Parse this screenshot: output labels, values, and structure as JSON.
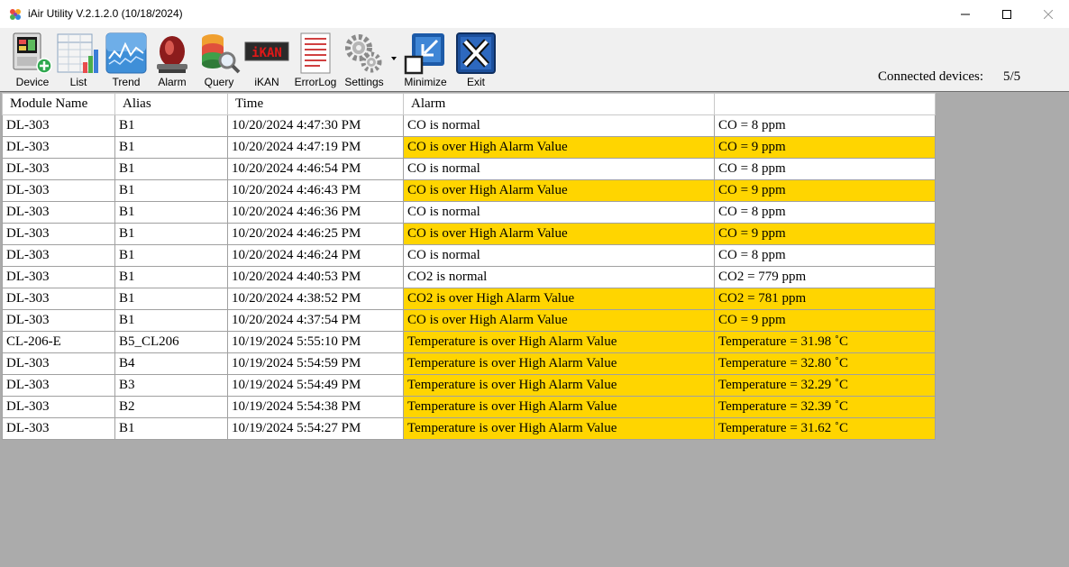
{
  "window": {
    "title": "iAir Utility V.2.1.2.0 (10/18/2024)",
    "icon": "app-flower-icon"
  },
  "toolbar": {
    "buttons": [
      {
        "label": "Device",
        "icon": "device-add-icon"
      },
      {
        "label": "List",
        "icon": "list-chart-icon"
      },
      {
        "label": "Trend",
        "icon": "trend-chart-icon"
      },
      {
        "label": "Alarm",
        "icon": "alarm-siren-icon"
      },
      {
        "label": "Query",
        "icon": "database-query-icon"
      },
      {
        "label": "iKAN",
        "icon": "ikan-display-icon"
      },
      {
        "label": "ErrorLog",
        "icon": "error-log-icon"
      },
      {
        "label": "Settings",
        "icon": "gears-icon"
      },
      {
        "label": "Minimize",
        "icon": "minimize-window-icon"
      },
      {
        "label": "Exit",
        "icon": "exit-x-icon"
      }
    ],
    "connected_label": "Connected devices:",
    "connected_value": "5/5"
  },
  "grid": {
    "headers": [
      "Module Name",
      "Alias",
      "Time",
      "Alarm",
      ""
    ],
    "rows": [
      {
        "module": "DL-303",
        "alias": "B1",
        "time": "10/20/2024 4:47:30 PM",
        "alarm": "CO is normal",
        "value": "CO = 8 ppm",
        "highlight": false
      },
      {
        "module": "DL-303",
        "alias": "B1",
        "time": "10/20/2024 4:47:19 PM",
        "alarm": "CO is over High Alarm  Value",
        "value": "CO = 9 ppm",
        "highlight": true
      },
      {
        "module": "DL-303",
        "alias": "B1",
        "time": "10/20/2024 4:46:54 PM",
        "alarm": "CO is normal",
        "value": "CO = 8 ppm",
        "highlight": false
      },
      {
        "module": "DL-303",
        "alias": "B1",
        "time": "10/20/2024 4:46:43 PM",
        "alarm": "CO is over High Alarm  Value",
        "value": "CO = 9 ppm",
        "highlight": true
      },
      {
        "module": "DL-303",
        "alias": "B1",
        "time": "10/20/2024 4:46:36 PM",
        "alarm": "CO is normal",
        "value": "CO = 8 ppm",
        "highlight": false
      },
      {
        "module": "DL-303",
        "alias": "B1",
        "time": "10/20/2024 4:46:25 PM",
        "alarm": "CO is over High Alarm  Value",
        "value": "CO = 9 ppm",
        "highlight": true
      },
      {
        "module": "DL-303",
        "alias": "B1",
        "time": "10/20/2024 4:46:24 PM",
        "alarm": "CO is normal",
        "value": "CO = 8 ppm",
        "highlight": false
      },
      {
        "module": "DL-303",
        "alias": "B1",
        "time": "10/20/2024 4:40:53 PM",
        "alarm": "CO2 is normal",
        "value": "CO2 = 779 ppm",
        "highlight": false
      },
      {
        "module": "DL-303",
        "alias": "B1",
        "time": "10/20/2024 4:38:52 PM",
        "alarm": "CO2 is over High Alarm  Value",
        "value": "CO2 = 781 ppm",
        "highlight": true
      },
      {
        "module": "DL-303",
        "alias": "B1",
        "time": "10/20/2024 4:37:54 PM",
        "alarm": "CO is over High Alarm  Value",
        "value": "CO = 9 ppm",
        "highlight": true
      },
      {
        "module": "CL-206-E",
        "alias": "B5_CL206",
        "time": "10/19/2024 5:55:10 PM",
        "alarm": "Temperature is over High Alarm  Value",
        "value": "Temperature = 31.98 ˚C",
        "highlight": true
      },
      {
        "module": "DL-303",
        "alias": "B4",
        "time": "10/19/2024 5:54:59 PM",
        "alarm": "Temperature is over High Alarm  Value",
        "value": "Temperature = 32.80 ˚C",
        "highlight": true
      },
      {
        "module": "DL-303",
        "alias": "B3",
        "time": "10/19/2024 5:54:49 PM",
        "alarm": "Temperature is over High Alarm  Value",
        "value": "Temperature = 32.29 ˚C",
        "highlight": true
      },
      {
        "module": "DL-303",
        "alias": "B2",
        "time": "10/19/2024 5:54:38 PM",
        "alarm": "Temperature is over High Alarm  Value",
        "value": "Temperature = 32.39 ˚C",
        "highlight": true
      },
      {
        "module": "DL-303",
        "alias": "B1",
        "time": "10/19/2024 5:54:27 PM",
        "alarm": "Temperature is over High Alarm  Value",
        "value": "Temperature = 31.62 ˚C",
        "highlight": true
      }
    ]
  },
  "colors": {
    "alarm_highlight": "#ffd500",
    "grid_background": "#ababab",
    "exit_blue": "#1c4f9c"
  }
}
